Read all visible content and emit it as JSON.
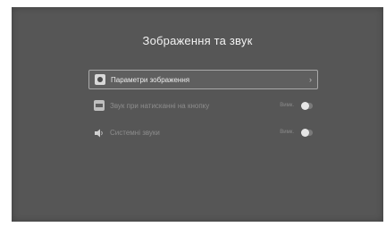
{
  "screen": {
    "title": "Зображення та звук"
  },
  "menu": {
    "items": [
      {
        "label": "Параметри зображення",
        "icon": "picture-settings-icon",
        "selected": true,
        "chevron": "›"
      },
      {
        "label": "Звук при натисканні на кнопку",
        "icon": "hdmi-icon",
        "state": "Вимк.",
        "enabled": false
      },
      {
        "label": "Системні звуки",
        "icon": "speaker-icon",
        "state": "Вимк.",
        "enabled": false
      }
    ]
  },
  "colors": {
    "screen_background": "#565656",
    "text": "#ececec",
    "dim_text": "#8d8d8d",
    "highlight_border": "#a8a8a8"
  }
}
